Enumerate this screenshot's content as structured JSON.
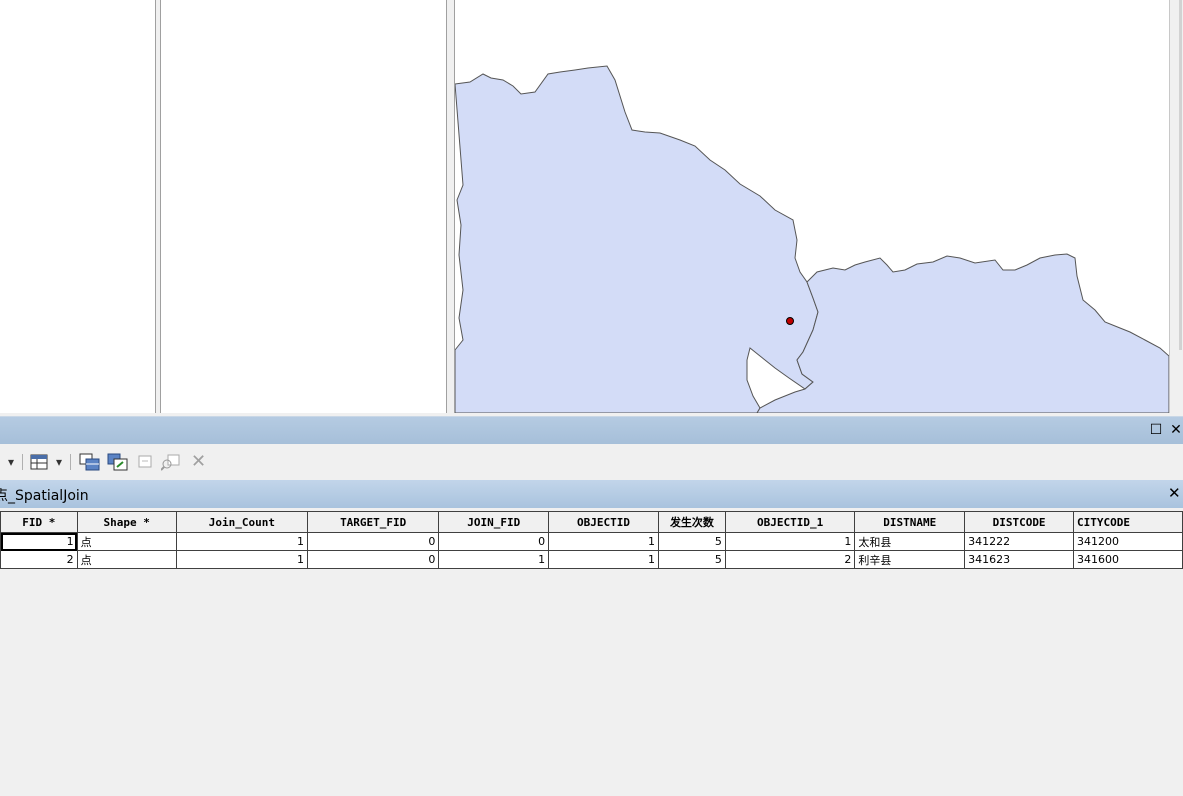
{
  "window": {
    "maximize_icon": "☐",
    "close_icon": "✕"
  },
  "toolbar": {
    "icons": [
      "dropdown-arrow-icon",
      "table-options-icon",
      "dropdown-arrow-icon",
      "related-tables-icon",
      "select-by-attributes-icon",
      "switch-selection-icon",
      "clear-selection-icon",
      "zoom-to-selected-icon",
      "delete-selected-icon"
    ]
  },
  "table_tab": {
    "title": "点_SpatialJoin",
    "close_icon": "✕"
  },
  "table": {
    "columns": [
      "FID *",
      "Shape *",
      "Join_Count",
      "TARGET_FID",
      "JOIN_FID",
      "OBJECTID",
      "发生次数",
      "OBJECTID_1",
      "DISTNAME",
      "DISTCODE",
      "CITYCODE"
    ],
    "rows": [
      [
        "1",
        "点",
        "1",
        "0",
        "0",
        "1",
        "5",
        "1",
        "太和县",
        "341222",
        "341200"
      ],
      [
        "2",
        "点",
        "1",
        "0",
        "1",
        "1",
        "5",
        "2",
        "利辛县",
        "341623",
        "341600"
      ]
    ]
  },
  "map": {
    "polygon_fill": "#d3dcf7",
    "polygon_stroke": "#555555",
    "point_color": "#c00000"
  }
}
